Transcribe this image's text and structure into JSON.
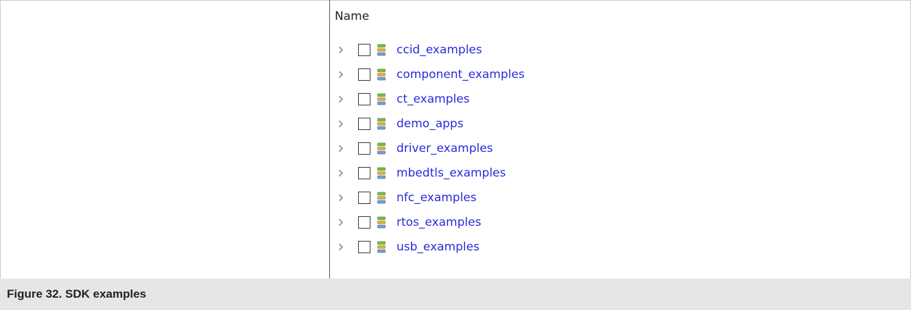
{
  "tree": {
    "column_header": "Name",
    "items": [
      {
        "label": "ccid_examples"
      },
      {
        "label": "component_examples"
      },
      {
        "label": "ct_examples"
      },
      {
        "label": "demo_apps"
      },
      {
        "label": "driver_examples"
      },
      {
        "label": "mbedtls_examples"
      },
      {
        "label": "nfc_examples"
      },
      {
        "label": "rtos_examples"
      },
      {
        "label": "usb_examples"
      }
    ],
    "icons": {
      "expander": "chevron-right-icon",
      "item": "package-folder-icon"
    },
    "colors": {
      "item_text": "#2a2adb",
      "icon_green": "#7fb84a",
      "icon_tan": "#d9b64a",
      "icon_blue": "#7a9fd0"
    }
  },
  "caption": {
    "text": "Figure 32.  SDK examples"
  }
}
